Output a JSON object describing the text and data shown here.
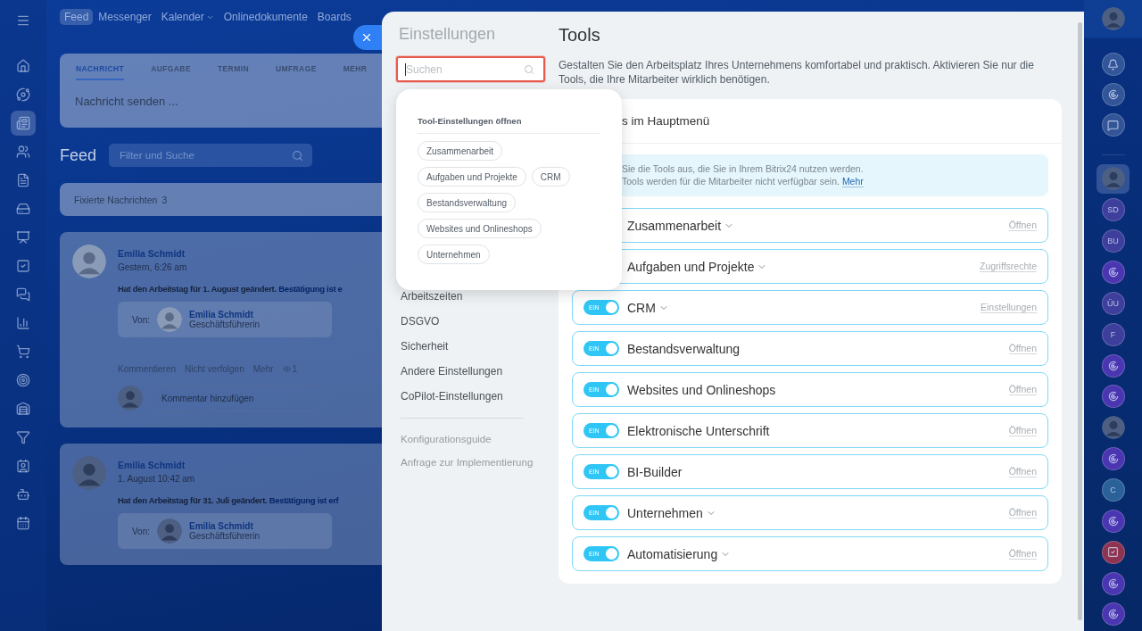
{
  "app_nav": {
    "items": [
      {
        "label": "Feed",
        "selected": true,
        "dropdown": false
      },
      {
        "label": "Messenger",
        "selected": false,
        "dropdown": false
      },
      {
        "label": "Kalender",
        "selected": false,
        "dropdown": true
      },
      {
        "label": "Onlinedokumente",
        "selected": false,
        "dropdown": false
      },
      {
        "label": "Boards",
        "selected": false,
        "dropdown": false
      }
    ]
  },
  "left_sidebar": {
    "items": [
      {
        "selected": false
      },
      {
        "selected": false
      },
      {
        "selected": true
      },
      {
        "selected": false
      },
      {
        "selected": false
      },
      {
        "selected": false
      },
      {
        "selected": false
      },
      {
        "selected": false
      },
      {
        "selected": false
      },
      {
        "selected": false
      },
      {
        "selected": false
      },
      {
        "selected": false
      },
      {
        "selected": false
      },
      {
        "selected": false
      },
      {
        "selected": false
      },
      {
        "selected": false
      },
      {
        "selected": false
      }
    ]
  },
  "composer": {
    "tabs": [
      {
        "label": "NACHRICHT",
        "selected": true
      },
      {
        "label": "AUFGABE",
        "selected": false
      },
      {
        "label": "TERMIN",
        "selected": false
      },
      {
        "label": "UMFRAGE",
        "selected": false
      },
      {
        "label": "MEHR",
        "selected": false
      }
    ],
    "placeholder": "Nachricht senden ..."
  },
  "feed": {
    "title": "Feed",
    "filter": {
      "placeholder": "Filter und Suche"
    },
    "pinned": {
      "label": "Fixierte Nachrichten",
      "count": "3"
    },
    "posts": [
      {
        "author": "Emilia Schmidt",
        "time": "Gestern, 6:26 am",
        "text": "Hat den Arbeitstag für 1. August geändert.",
        "link": "Bestätigung ist e",
        "from_label": "Von:",
        "from_name": "Emilia Schmidt",
        "from_role": "Geschäftsführerin",
        "actions": [
          "Kommentieren",
          "Nicht verfolgen",
          "Mehr"
        ],
        "views": "1",
        "comment_placeholder": "Kommentar hinzufügen"
      },
      {
        "author": "Emilia Schmidt",
        "time": "1. August 10:42 am",
        "text": "Hat den Arbeitstag für 31. Juli geändert.",
        "link": "Bestätigung ist erf",
        "from_label": "Von:",
        "from_name": "Emilia Schmidt",
        "from_role": "Geschäftsführerin"
      }
    ]
  },
  "settings": {
    "title": "Einstellungen",
    "search": {
      "placeholder": "Suchen",
      "focused": true
    },
    "menu": [
      "Arbeitszeiten",
      "DSGVO",
      "Sicherheit",
      "Andere Einstellungen",
      "CoPilot-Einstellungen"
    ],
    "links": [
      "Konfigurationsguide",
      "Anfrage zur Implementierung"
    ],
    "popup": {
      "title": "Tool-Einstellungen öffnen",
      "chips": [
        "Zusammenarbeit",
        "Aufgaben und Projekte",
        "CRM",
        "Bestandsverwaltung",
        "Websites und Onlineshops",
        "Unternehmen"
      ]
    }
  },
  "tools": {
    "title": "Tools",
    "description": "Gestalten Sie den Arbeitsplatz Ihres Unternehmens komfortabel und praktisch. Aktivieren Sie nur die Tools, die Ihre Mitarbeiter wirklich benötigen.",
    "card_title": "s im Hauptmenü",
    "info": [
      "Sie die Tools aus, die Sie in Ihrem Bitrix24 nutzen werden.",
      "Tools werden für die Mitarbeiter nicht verfügbar sein."
    ],
    "info_link": "Mehr",
    "rows": [
      {
        "name": "Zusammenarbeit",
        "expandable": true,
        "action": "Öffnen"
      },
      {
        "name": "Aufgaben und Projekte",
        "expandable": true,
        "action": "Zugriffsrechte"
      },
      {
        "name": "CRM",
        "on": true,
        "toggle_label": "EIN",
        "expandable": true,
        "action": "Einstellungen"
      },
      {
        "name": "Bestandsverwaltung",
        "on": true,
        "toggle_label": "EIN",
        "expandable": false,
        "action": "Öffnen"
      },
      {
        "name": "Websites und Onlineshops",
        "on": true,
        "toggle_label": "EIN",
        "expandable": false,
        "action": "Öffnen"
      },
      {
        "name": "Elektronische Unterschrift",
        "on": true,
        "toggle_label": "EIN",
        "expandable": false,
        "action": "Öffnen"
      },
      {
        "name": "BI-Builder",
        "on": true,
        "toggle_label": "EIN",
        "expandable": false,
        "action": "Öffnen"
      },
      {
        "name": "Unternehmen",
        "on": true,
        "toggle_label": "EIN",
        "expandable": true,
        "action": "Öffnen"
      },
      {
        "name": "Automatisierung",
        "on": true,
        "toggle_label": "EIN",
        "expandable": true,
        "action": "Öffnen"
      }
    ]
  },
  "right_bar": {
    "tools": [
      {
        "kind": "avatar"
      },
      {
        "kind": "bell"
      },
      {
        "kind": "swirl"
      },
      {
        "kind": "chat"
      }
    ],
    "chats": [
      {
        "kind": "avatar",
        "selected": true
      },
      {
        "kind": "initials",
        "text": "SD",
        "selected": false,
        "color": "#3e3f9c"
      },
      {
        "kind": "initials",
        "text": "BU",
        "selected": false,
        "color": "#3e3f9c"
      },
      {
        "kind": "swirl",
        "selected": false,
        "color": "#4a36b0"
      },
      {
        "kind": "initials",
        "text": "ÜU",
        "selected": false,
        "color": "#3e3f9c"
      },
      {
        "kind": "initials",
        "text": "F",
        "selected": false,
        "color": "#3e3f9c"
      },
      {
        "kind": "swirl",
        "selected": false,
        "color": "#4a36b0"
      },
      {
        "kind": "swirl",
        "selected": false,
        "color": "#4a36b0"
      },
      {
        "kind": "avatar",
        "selected": false
      },
      {
        "kind": "swirl",
        "selected": false,
        "color": "#4a36b0"
      },
      {
        "kind": "initials",
        "text": "C",
        "selected": false,
        "color": "#2a6199"
      },
      {
        "kind": "swirl",
        "selected": false,
        "color": "#4a36b0"
      },
      {
        "kind": "task",
        "selected": false,
        "color": "#8e3453"
      },
      {
        "kind": "swirl",
        "selected": false,
        "color": "#4a36b0"
      },
      {
        "kind": "swirl",
        "selected": false,
        "color": "#4a36b0"
      }
    ]
  }
}
